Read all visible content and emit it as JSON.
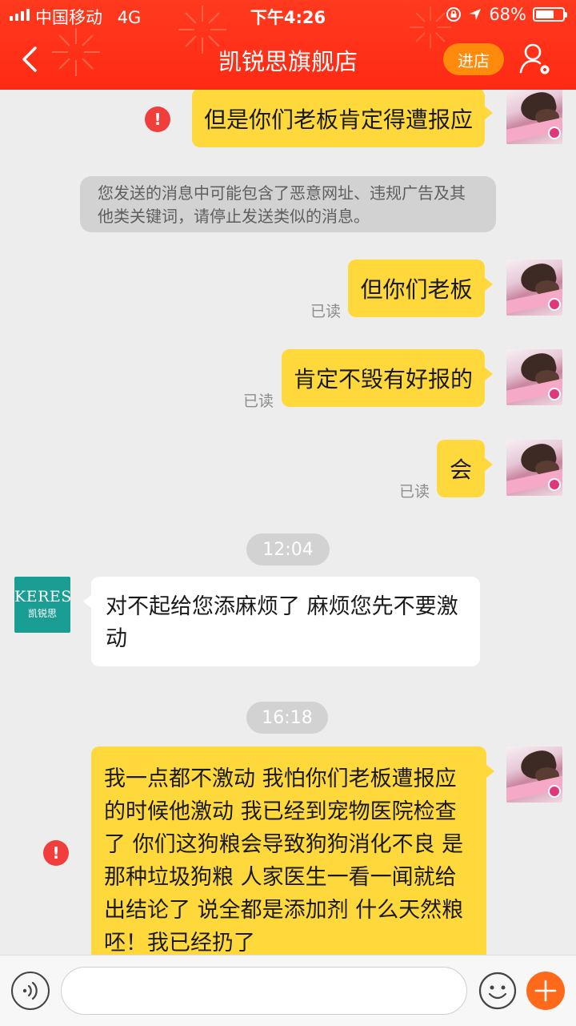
{
  "status_bar": {
    "carrier": "中国移动",
    "network": "4G",
    "time": "下午4:26",
    "battery_text": "68%",
    "battery_level": 0.68
  },
  "nav": {
    "back_icon": "chevron-left-icon",
    "title": "凯锐思旗舰店",
    "enter_store": "进店",
    "user_icon": "user-settings-icon"
  },
  "colors": {
    "header": "#ff2a14",
    "my_bubble": "#ffd93b",
    "enter_button": "#ff8a0c",
    "alert": "#f23d3d",
    "plus_button": "#ff6a1a",
    "shop_avatar": "#1a9e94"
  },
  "messages": {
    "m1": {
      "text": "但是你们老板肯定得遭报应",
      "failed_mark": "!"
    },
    "system_notice": "您发送的消息中可能包含了恶意网址、违规广告及其他类关键词，请停止发送类似的消息。",
    "m2": {
      "text": "但你们老板",
      "status": "已读"
    },
    "m3": {
      "text": "肯定不毁有好报的",
      "status": "已读"
    },
    "m4": {
      "text": "会",
      "status": "已读"
    },
    "time1": "12:04",
    "shop_reply": {
      "avatar_brand": "KERES",
      "avatar_sub": "凯锐思",
      "text": "对不起给您添麻烦了 麻烦您先不要激动"
    },
    "time2": "16:18",
    "m5": {
      "text": "我一点都不激动 我怕你们老板遭报应的时候他激动 我已经到宠物医院检查了 你们这狗粮会导致狗狗消化不良 是那种垃圾狗粮 人家医生一看一闻就给出结论了 说全都是添加剂 什么天然粮呸！我已经扔了",
      "failed_mark": "!"
    }
  },
  "input_bar": {
    "voice_icon": "voice-icon",
    "placeholder": "",
    "emoji_icon": "emoji-icon",
    "plus_icon": "plus-icon"
  }
}
